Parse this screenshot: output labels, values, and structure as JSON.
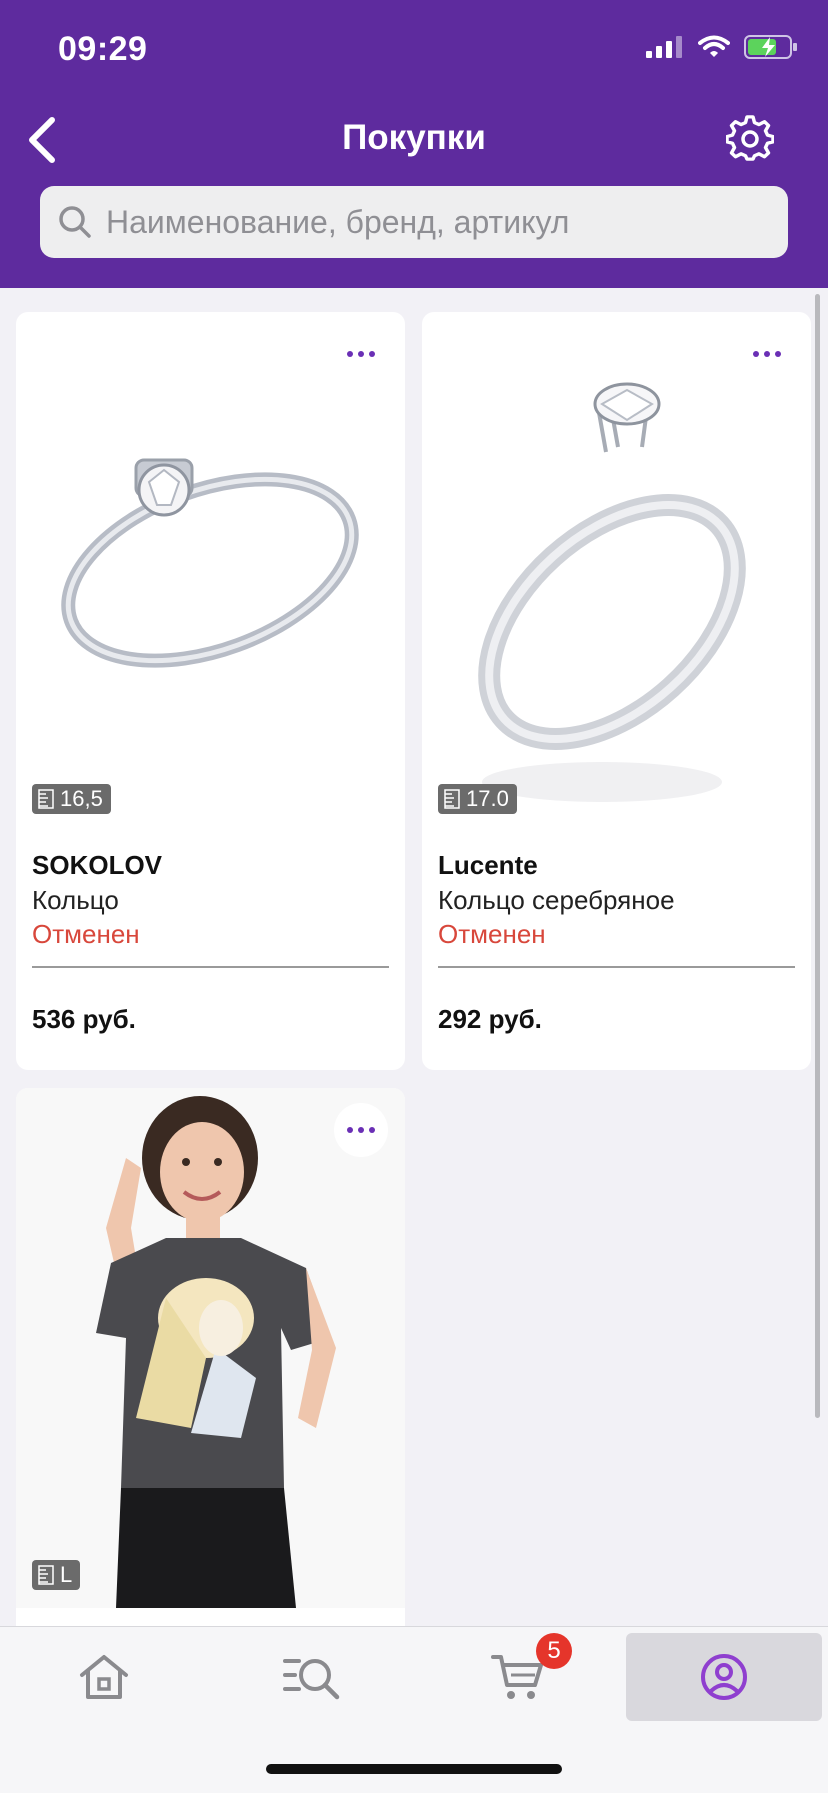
{
  "status_bar": {
    "time": "09:29"
  },
  "header": {
    "title": "Покупки"
  },
  "search": {
    "placeholder": "Наименование, бренд, артикул"
  },
  "products": [
    {
      "size": "16,5",
      "brand": "SOKOLOV",
      "name": "Кольцо",
      "status": "Отменен",
      "price": "536 руб."
    },
    {
      "size": "17.0",
      "brand": "Lucente",
      "name": "Кольцо серебряное",
      "status": "Отменен",
      "price": "292 руб."
    },
    {
      "size": "L"
    }
  ],
  "tabbar": {
    "cart_count": "5"
  },
  "colors": {
    "brand_purple": "#5e2b9e",
    "status_red": "#d8473b",
    "badge_red": "#e5352b"
  }
}
